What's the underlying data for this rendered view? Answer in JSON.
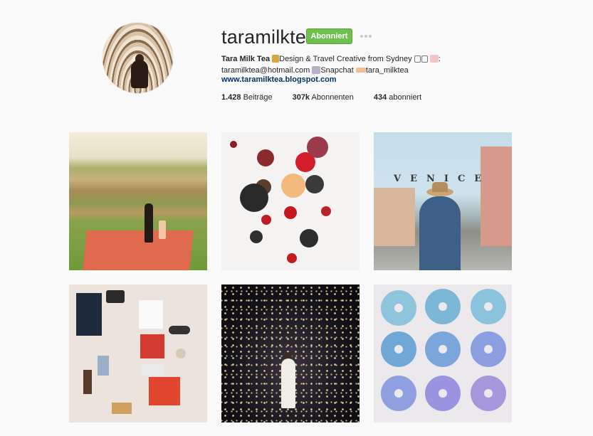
{
  "profile": {
    "username": "taramilktea",
    "follow_label": "Abonniert",
    "more_label": "",
    "bio": {
      "name": "Tara Milk Tea",
      "line1_rest": "Design & Travel Creative from Sydney",
      "line1_suffix": ":",
      "email": "taramilktea@hotmail.com",
      "snapchat_label": "Snapchat",
      "snapchat_handle": "tara_milktea",
      "link": "www.taramilktea.blogspot.com"
    },
    "stats": {
      "posts_count": "1.428",
      "posts_label": "Beiträge",
      "followers_count": "307k",
      "followers_label": "Abonnenten",
      "following_count": "434",
      "following_label": "abonniert"
    }
  },
  "posts": [
    {
      "subject": "vineyard picnic"
    },
    {
      "subject": "tea flat lay"
    },
    {
      "subject": "venice sign"
    },
    {
      "subject": "desk flat lay"
    },
    {
      "subject": "infinity mirror room"
    },
    {
      "subject": "blue donuts"
    }
  ],
  "colors": {
    "accent_green": "#70c050",
    "link_blue": "#003569",
    "background": "#fafafa"
  }
}
